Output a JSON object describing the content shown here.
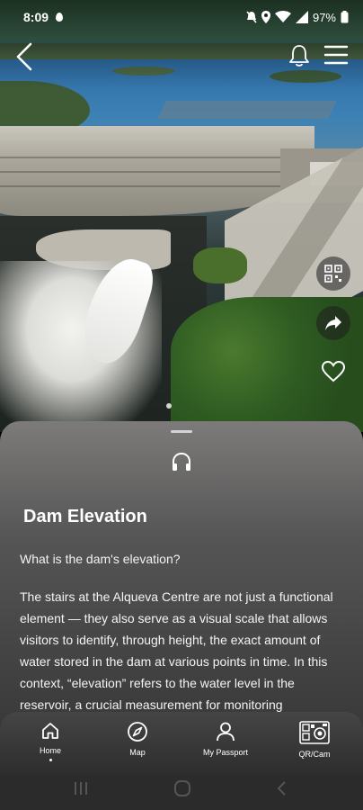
{
  "status_bar": {
    "time": "8:09",
    "battery": "97%"
  },
  "sheet": {
    "title": "Dam Elevation",
    "question": "What is the dam's elevation?",
    "body": "The stairs at the Alqueva Centre are not just a functional element — they also serve as a visual scale that allows visitors to identify, through height, the exact amount of water stored in the dam at various points in time. In this context, “elevation” refers to the water level in the reservoir, a crucial measurement for monitoring"
  },
  "bottom_nav": {
    "items": [
      {
        "label": "Home",
        "icon": "home-icon"
      },
      {
        "label": "Map",
        "icon": "compass-icon"
      },
      {
        "label": "My Passport",
        "icon": "person-icon"
      },
      {
        "label": "QR/Cam",
        "icon": "qr-camera-icon"
      }
    ]
  },
  "colors": {
    "sheet_top": "#7c7b7a",
    "sheet_bottom": "#2e2d2d",
    "nav_bg": "#3a3a3a"
  }
}
